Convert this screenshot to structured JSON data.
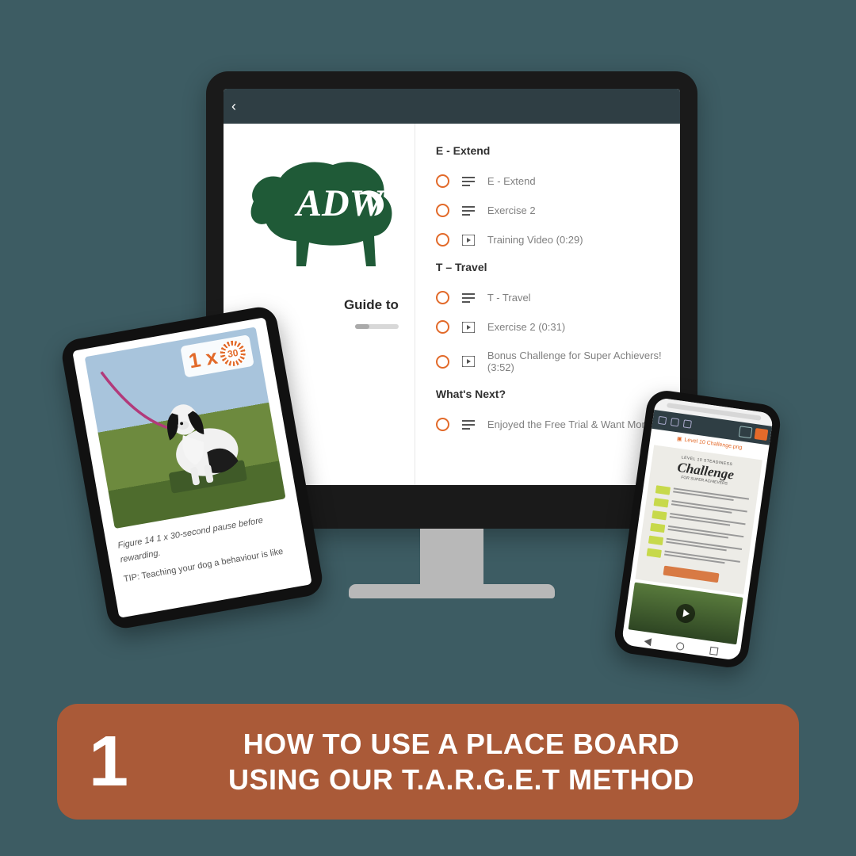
{
  "logo_text": "ADW",
  "guide_partial": "Guide to",
  "sections": {
    "extend": {
      "title": "E - Extend",
      "rows": [
        {
          "icon": "text",
          "label": "E - Extend"
        },
        {
          "icon": "text",
          "label": "Exercise 2"
        },
        {
          "icon": "video",
          "label": "Training Video (0:29)"
        }
      ]
    },
    "travel": {
      "title": "T – Travel",
      "rows": [
        {
          "icon": "text",
          "label": "T - Travel"
        },
        {
          "icon": "video",
          "label": "Exercise 2 (0:31)"
        },
        {
          "icon": "video",
          "label": "Bonus Challenge for Super Achievers! (3:52)"
        }
      ]
    },
    "next": {
      "title": "What's Next?",
      "rows": [
        {
          "icon": "text",
          "label": "Enjoyed the Free Trial & Want More?"
        }
      ]
    }
  },
  "tablet": {
    "badge_left": "1 x",
    "badge_ring": "30",
    "caption": "Figure 14 1 x 30-second pause before rewarding.",
    "tip": "TIP: Teaching your dog a behaviour is like"
  },
  "phone": {
    "file_label": "Level 10 Challenge.png",
    "eyebrow": "LEVEL 10 STEADINESS",
    "title": "Challenge",
    "subtitle": "FOR SUPER ACHIEVERS"
  },
  "banner": {
    "number": "1",
    "line1": "HOW TO USE A PLACE BOARD",
    "line2": "USING OUR T.A.R.G.E.T METHOD"
  }
}
